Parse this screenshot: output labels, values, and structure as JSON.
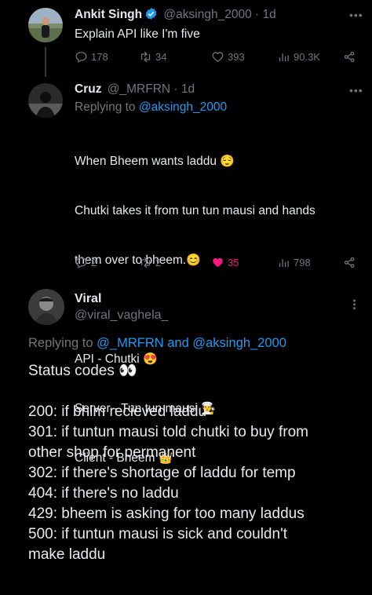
{
  "tweet1": {
    "name": "Ankit Singh",
    "handle": "@aksingh_2000",
    "time": "· 1d",
    "text": "Explain API like I'm five",
    "replies": "178",
    "retweets": "34",
    "likes": "393",
    "views": "90.3K"
  },
  "tweet2": {
    "name": "Cruz",
    "handle": "@_MRFRN",
    "time": "· 1d",
    "replying_prefix": "Replying to",
    "replying_to": "@aksingh_2000",
    "lines": [
      "When Bheem wants laddu",
      "Chutki takes it from tun tun mausi and hands",
      "them over to bheem.",
      "",
      "API - Chutki",
      "Server - Tun tun mausi",
      "Client - Bheem"
    ],
    "emojis": [
      "😌",
      "😊",
      "😍",
      "🧑‍🍳",
      "👑"
    ],
    "replies": "2",
    "retweets": "2",
    "likes": "35",
    "views": "798"
  },
  "tweet3": {
    "name": "Viral",
    "handle": "@viral_vaghela_",
    "replying_prefix": "Replying to",
    "replying_to_1": "@_MRFRN",
    "replying_and": "and",
    "replying_to_2": "@aksingh_2000",
    "headline": "Status codes",
    "headline_emoji": "👀",
    "lines": [
      "200: if bhim recieved laddu",
      "301: if tuntun mausi told chutki to buy from",
      "other shop for permanent",
      "302: if there's shortage of laddu for temp",
      "404: if there's no laddu",
      "429: bheem is asking for too many laddus",
      "500: if tuntun mausi is sick and couldn't",
      "make laddu"
    ]
  },
  "colors": {
    "background": "#000000",
    "text": "#e7e9ea",
    "muted": "#71767b",
    "link": "#1d9bf0",
    "like_active": "#f91880",
    "verified": "#1d9bf0"
  },
  "icons": [
    "verified-badge-icon",
    "reply-icon",
    "retweet-icon",
    "like-icon",
    "views-icon",
    "share-icon",
    "more-icon"
  ]
}
